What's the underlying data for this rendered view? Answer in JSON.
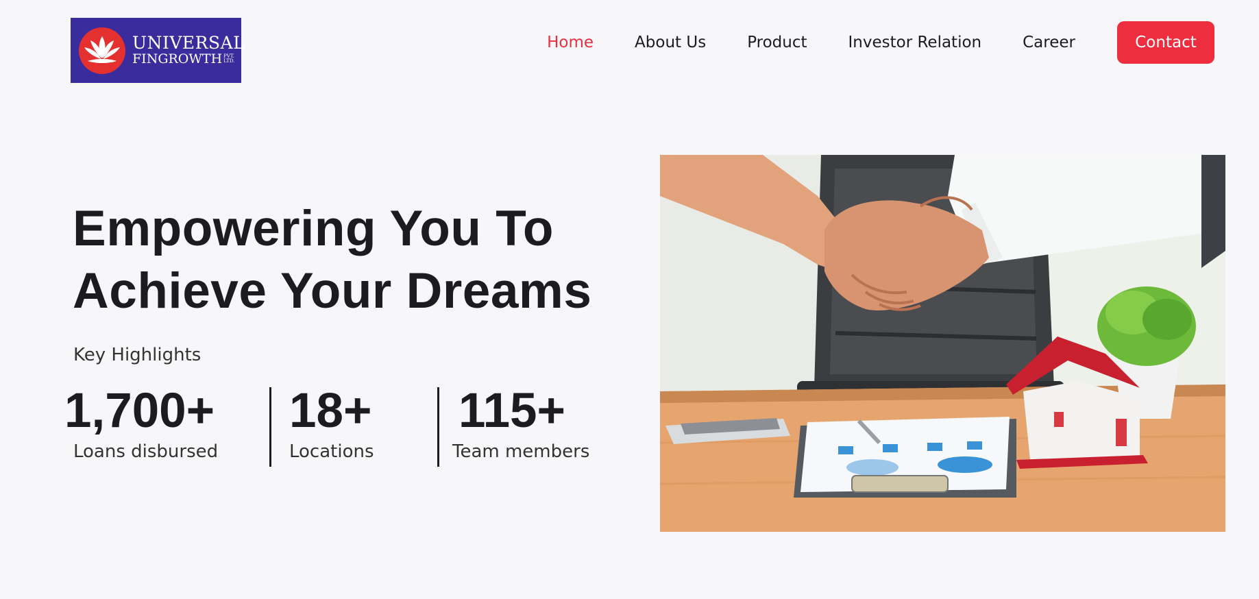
{
  "brand": {
    "name_line1": "UNIVERSAL",
    "name_line2": "FINGROWTH",
    "suffix_line1": "PVT.",
    "suffix_line2": "LTD.",
    "logo_bg": "#3a2c9c",
    "emblem_color": "#e53030",
    "emblem_icon": "lotus-icon"
  },
  "nav": {
    "items": [
      {
        "label": "Home",
        "active": true
      },
      {
        "label": "About Us",
        "active": false
      },
      {
        "label": "Product",
        "active": false
      },
      {
        "label": "Investor Relation",
        "active": false
      },
      {
        "label": "Career",
        "active": false
      }
    ],
    "contact_label": "Contact",
    "accent_color": "#ee2e3f"
  },
  "hero": {
    "title_line1": "Empowering You To",
    "title_line2": "Achieve Your Dreams",
    "highlights_label": "Key Highlights",
    "stats": [
      {
        "value": "1,700+",
        "label": "Loans disbursed"
      },
      {
        "value": "18+",
        "label": "Locations"
      },
      {
        "value": "115+",
        "label": "Team members"
      }
    ]
  }
}
